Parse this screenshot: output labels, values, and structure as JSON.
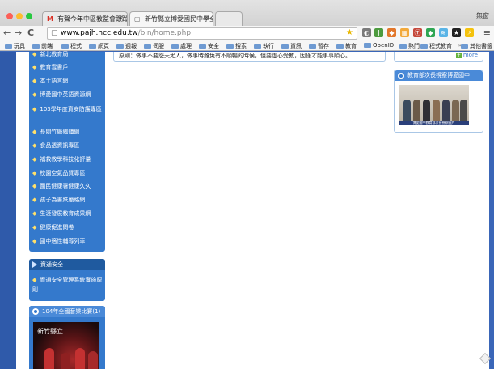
{
  "browser": {
    "tabs": [
      {
        "favicon": "M",
        "title": "有聲今年中區教監會跟蹤結...",
        "close": "×"
      },
      {
        "favicon": "▢",
        "title": "新竹縣立博愛國民中學全球資...",
        "close": "×"
      }
    ],
    "window_label": "無窗",
    "nav": {
      "back": "←",
      "forward": "→",
      "reload": "C"
    },
    "url_host": "www.pajh.hcc.edu.tw",
    "url_path": "/bin/home.php",
    "star": "★",
    "menu": "≡"
  },
  "bookmarks": {
    "items": [
      "玩具",
      "前端",
      "程式",
      "網頁",
      "週報",
      "伺服",
      "處理",
      "安全",
      "搜索",
      "執行",
      "資訊",
      "暫存",
      "教育",
      "OpenID",
      "熱門",
      "程式教育"
    ],
    "more": "»",
    "other": "其他書籤"
  },
  "sidebar": {
    "nav_items": [
      "新北教育局",
      "教育雲書戶",
      "本土語言網",
      "博愛國中英語資源網",
      "103學年度資安防護專區",
      "長閱竹縣鄉鎮網",
      "食品透資訊專區",
      "補救教學科技化評量",
      "校園空氣品質專區",
      "國民健康署健康久久",
      "孩子為書跌嚴格網",
      "生涯發展教育成果網",
      "健康促進問卷",
      "國中適性輔導列車"
    ],
    "traffic": {
      "title": "資通安全",
      "item": "資通安全管理系統實施原則"
    },
    "music": {
      "title": "104年全國音樂比賽(1)",
      "video_title": "新竹縣立..."
    }
  },
  "center": {
    "text": "原則：做事不要怨天尤人，做事時難免有不順暢的時候，但要虛心受教，因僅才能事事順心。"
  },
  "right": {
    "more_link": "more",
    "minister_title": "教育部次長視察博愛國中",
    "photo_caption": "博愛國中教育部次長視察圖片"
  },
  "icons": {
    "diamond": "◆",
    "flag": "flag-icon"
  },
  "colors": {
    "nav_panel": "#3479cc",
    "bullet": "#ffe06a",
    "accent": "#4a8ad8"
  }
}
